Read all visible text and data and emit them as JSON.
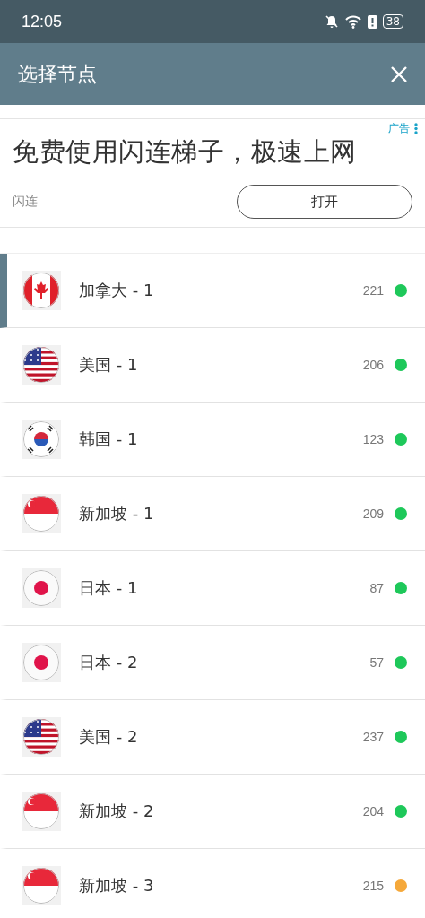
{
  "status_bar": {
    "time": "12:05",
    "battery": "38"
  },
  "header": {
    "title": "选择节点"
  },
  "ad": {
    "tag": "广告",
    "headline": "免费使用闪连梯子，极速上网",
    "brand": "闪连",
    "button": "打开"
  },
  "nodes": [
    {
      "kind": "canada",
      "name": "加拿大 - 1",
      "ping": "221",
      "color": "#1ec85a",
      "selected": true
    },
    {
      "kind": "usa",
      "name": "美国 - 1",
      "ping": "206",
      "color": "#1ec85a",
      "selected": false
    },
    {
      "kind": "korea",
      "name": "韩国 - 1",
      "ping": "123",
      "color": "#1ec85a",
      "selected": false
    },
    {
      "kind": "singapore",
      "name": "新加坡 - 1",
      "ping": "209",
      "color": "#1ec85a",
      "selected": false
    },
    {
      "kind": "japan",
      "name": "日本 - 1",
      "ping": "87",
      "color": "#1ec85a",
      "selected": false
    },
    {
      "kind": "japan",
      "name": "日本 - 2",
      "ping": "57",
      "color": "#1ec85a",
      "selected": false
    },
    {
      "kind": "usa",
      "name": "美国 - 2",
      "ping": "237",
      "color": "#1ec85a",
      "selected": false
    },
    {
      "kind": "singapore",
      "name": "新加坡 - 2",
      "ping": "204",
      "color": "#1ec85a",
      "selected": false
    },
    {
      "kind": "singapore",
      "name": "新加坡 - 3",
      "ping": "215",
      "color": "#f5a83a",
      "selected": false
    }
  ]
}
